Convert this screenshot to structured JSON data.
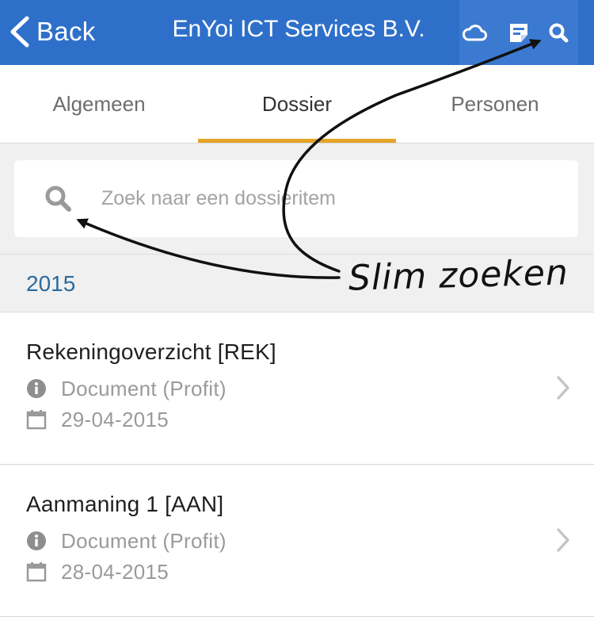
{
  "navbar": {
    "back_label": "Back",
    "title": "EnYoi ICT Services B.V.",
    "background": "#2e70c9",
    "icons": [
      "cloud-icon",
      "notes-icon",
      "search-icon"
    ]
  },
  "tabs": [
    {
      "label": "Algemeen",
      "active": false
    },
    {
      "label": "Dossier",
      "active": true
    },
    {
      "label": "Personen",
      "active": false
    }
  ],
  "tab_indicator_color": "#e6a42a",
  "search": {
    "placeholder": "Zoek naar een dossieritem",
    "value": ""
  },
  "section": {
    "title": "2015"
  },
  "items": [
    {
      "title": "Rekeningoverzicht [REK]",
      "type": "Document (Profit)",
      "date": "29-04-2015"
    },
    {
      "title": "Aanmaning 1 [AAN]",
      "type": "Document (Profit)",
      "date": "28-04-2015"
    }
  ],
  "annotation": {
    "label": "Slim zoeken"
  }
}
